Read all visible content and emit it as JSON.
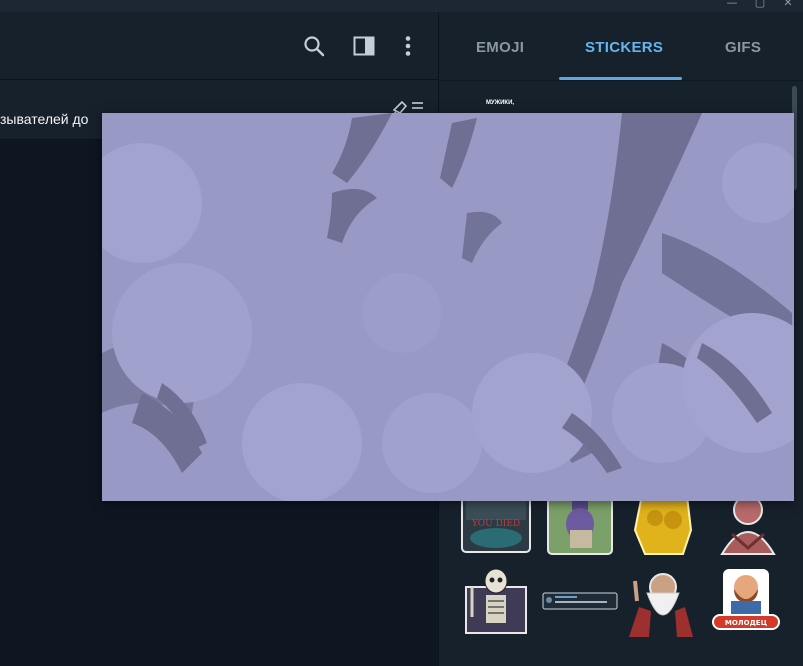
{
  "window": {
    "controls": [
      "minimize-icon",
      "maximize-icon",
      "close-icon"
    ]
  },
  "header": {
    "icons": [
      "search-icon",
      "sidebar-toggle-icon",
      "more-vertical-icon"
    ]
  },
  "pinned": {
    "text": "зывателей до",
    "icon": "pin-list-icon"
  },
  "panel": {
    "tabs": [
      {
        "label": "EMOJI",
        "active": false
      },
      {
        "label": "STICKERS",
        "active": true
      },
      {
        "label": "GIFS",
        "active": false
      }
    ],
    "set_title_lines": [
      "МУЖИКИ,"
    ],
    "stickers_row1": [
      "sticker-you-died",
      "sticker-robed-figure",
      "sticker-golden-statue",
      "sticker-pale-creature"
    ],
    "stickers_row2": [
      "sticker-skeleton",
      "sticker-chat-screenshot",
      "sticker-old-wizard",
      "sticker-bearded-man-badge"
    ],
    "sticker_texts": {
      "you_died": "YOU DIED",
      "badge": "МОЛОДЕЦ"
    }
  },
  "colors": {
    "accent": "#5aa8e6",
    "active_tab": "#64b5ef",
    "inactive_tab": "#8a97a3",
    "panel_bg": "#17212b",
    "chat_bg": "#0e1621",
    "preview_bg": "#9999c5"
  }
}
